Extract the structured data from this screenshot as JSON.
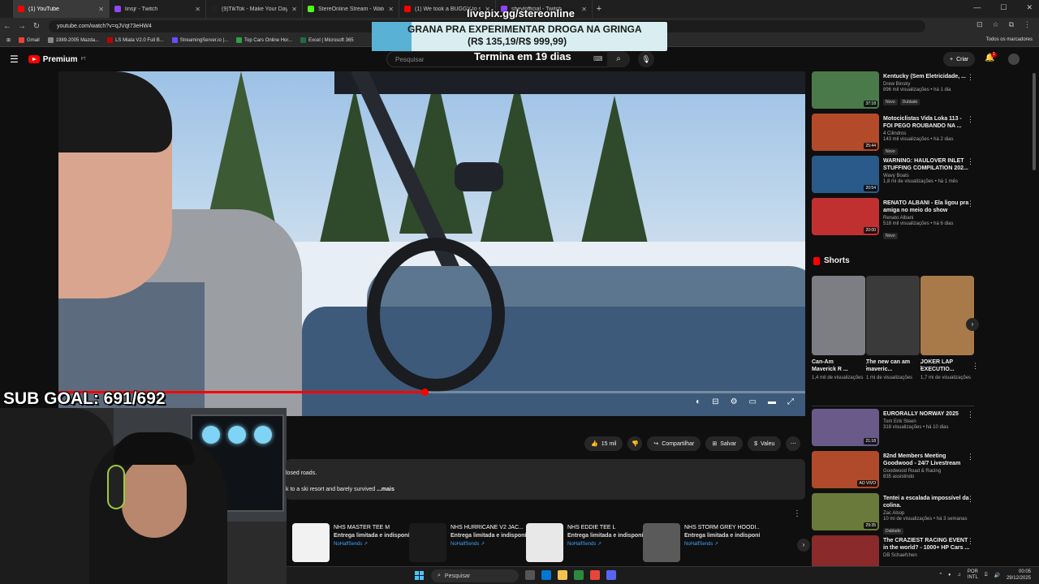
{
  "browser": {
    "tabs": [
      {
        "title": "(1) YouTube",
        "color": "#ff0000",
        "active": true
      },
      {
        "title": "linsjr - Twitch",
        "color": "#9146ff"
      },
      {
        "title": "(9)TikTok - Make Your Day",
        "color": "#222222"
      },
      {
        "title": "StereOnline Stream - Watch Li",
        "color": "#53fc18"
      },
      {
        "title": "(1) We took a BUGGY to s",
        "color": "#ff0000"
      },
      {
        "title": "sheylofficial - Twitch",
        "color": "#9146ff"
      }
    ],
    "new_tab": "+",
    "url": "youtube.com/watch?v=qJVqt73eHW4",
    "bookmarks": [
      {
        "label": "Gmail",
        "color": "#ea4335"
      },
      {
        "label": "1989-2005 Mazda...",
        "color": "#888888"
      },
      {
        "label": "LS Miata V2.0 Full B...",
        "color": "#c00000"
      },
      {
        "label": "StreamingServer.io |...",
        "color": "#6b4cff"
      },
      {
        "label": "Top Cars Online Hor...",
        "color": "#2ea043"
      },
      {
        "label": "Excel | Microsoft 365",
        "color": "#1d6f42"
      }
    ],
    "all_bookmarks": "Todos os marcadores"
  },
  "youtube": {
    "logo_text": "Premium",
    "logo_sup": "PT",
    "search_placeholder": "Pesquisar",
    "create_label": "Criar",
    "notif_count": "1"
  },
  "overlay": {
    "livepix": "livepix.gg/stereonline",
    "promo_line1": "GRANA PRA EXPERIMENTAR DROGA NA GRINGA",
    "promo_line2": "(R$ 135,19/R$ 999,99)",
    "ends": "Termina em 19 dias",
    "sub_goal": "SUB GOAL: 691/692",
    "promo_progress": 0.135
  },
  "player": {
    "progress": 0.49
  },
  "actions": {
    "likes": "15 mil",
    "share": "Compartilhar",
    "save": "Salvar",
    "thanks": "Valeu"
  },
  "description": {
    "line1": "losed roads.",
    "line2": "k to a ski resort and barely survived ",
    "more": "...mais"
  },
  "shelf": [
    {
      "name": "NHS MASTER TEE M",
      "avail": "Entrega limitada e indisponível",
      "store": "NoHalfSends ↗",
      "color": "#f2f2f2"
    },
    {
      "name": "NHS HURRICANE V2 JAC...",
      "avail": "Entrega limitada e indisponível",
      "store": "NoHalfSends ↗",
      "color": "#1b1b1b"
    },
    {
      "name": "NHS EDDIE TEE L",
      "avail": "Entrega limitada e indisponível",
      "store": "NoHalfSends ↗",
      "color": "#e8e8e8"
    },
    {
      "name": "NHS STORM GREY HOODI...",
      "avail": "Entrega limitada e indisponível",
      "store": "NoHalfSends ↗",
      "color": "#5a5a5a"
    }
  ],
  "sidebar": {
    "videos_top": [
      {
        "title": "Kentucky (Sem Eletricidade, ...",
        "channel": "Drew Binsky",
        "meta": "896 mil visualizações • há 1 dia",
        "badges": [
          "Novo",
          "Dublado"
        ],
        "duration": "37:18",
        "color": "#4a7a4a"
      },
      {
        "title": "Motociclistas Vida Loka 113 - FOI PEGO ROUBANDO NA ...",
        "channel": "4 Cilindros",
        "meta": "143 mil visualizações • há 2 dias",
        "badges": [
          "Novo"
        ],
        "duration": "25:44",
        "color": "#b34a2a"
      },
      {
        "title": "WARNING: HAULOVER INLET STUFFING COMPILATION 202...",
        "channel": "Wavy Boats",
        "meta": "1,8 mi de visualizações • há 1 mês",
        "badges": [],
        "duration": "20:54",
        "color": "#2a5a8a"
      },
      {
        "title": "RENATO ALBANI - Ela ligou pra amiga no meio do show",
        "channel": "Renato Albani",
        "meta": "518 mil visualizações • há 6 dias",
        "badges": [
          "Novo"
        ],
        "duration": "20:00",
        "color": "#c03030"
      }
    ],
    "shorts_heading": "Shorts",
    "shorts": [
      {
        "title": "Can-Am Maverick R ...",
        "meta": "1,4 mil de visualizações",
        "color": "#7c7e84"
      },
      {
        "title": "The new can am maveric...",
        "meta": "1 mi de visualizações",
        "color": "#3a3a3a"
      },
      {
        "title": "JOKER LAP EXECUTIO...",
        "meta": "1,7 mi de visualizações",
        "color": "#a87a4a"
      }
    ],
    "videos_bottom": [
      {
        "title": "EURORALLY NORWAY 2025",
        "channel": "Tom Erik Steen",
        "meta": "318 visualizações • há 10 dias",
        "badges": [],
        "duration": "21:18",
        "color": "#6a5a8a"
      },
      {
        "title": "82nd Members Meeting Goodwood - 24/7 Livestream",
        "channel": "Goodwood Road & Racing",
        "meta": "835 assistindo",
        "badges": [],
        "duration": "AO VIVO",
        "color": "#b04a2a"
      },
      {
        "title": "Tentei a escalada impossível da colina.",
        "channel": "Zac Alsop",
        "meta": "10 mi de visualizações • há 3 semanas",
        "badges": [
          "Dublado"
        ],
        "duration": "29:35",
        "color": "#6a7a3a"
      },
      {
        "title": "The CRAZIEST RACING EVENT in the world? - 1000+ HP Cars ...",
        "channel": "DB Schaefchen",
        "meta": "",
        "badges": [],
        "duration": "",
        "color": "#8a2a2a"
      }
    ]
  },
  "taskbar": {
    "search": "Pesquisar",
    "lang1": "POR",
    "lang2": "INTL",
    "time": "00:05",
    "date": "29/12/2025"
  }
}
